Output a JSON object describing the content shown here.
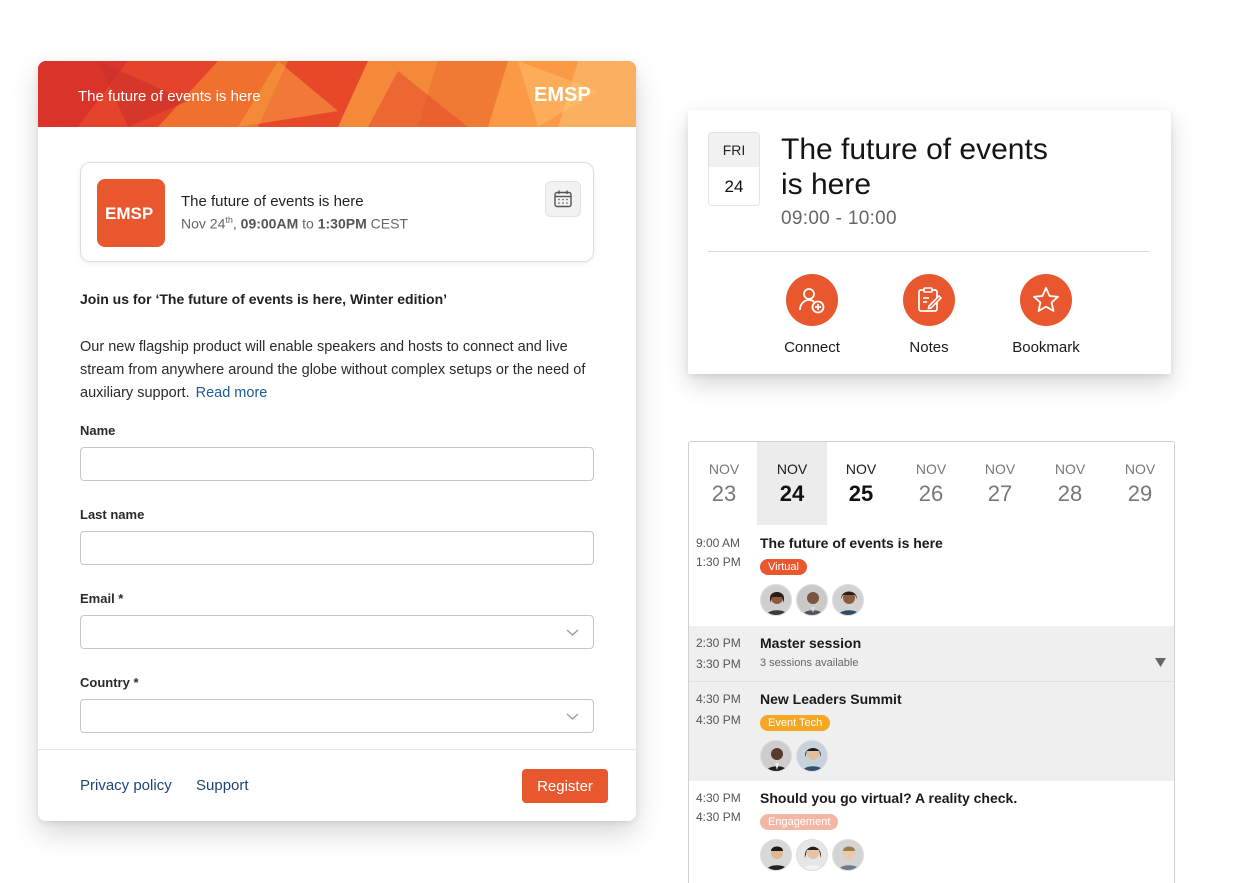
{
  "colors": {
    "brand_orange": "#e8572e",
    "tag_event_tech": "#f5a623",
    "tag_engagement": "#f5b7a5",
    "link_blue": "#1c4575"
  },
  "registration": {
    "banner_title": "The future of events is here",
    "brand_logo_text": "EMSP",
    "event": {
      "title": "The future of events is here",
      "date": "Nov 24",
      "date_suffix": "th",
      "date_comma": ",",
      "start": "09:00AM",
      "to": "to",
      "end": "1:30PM",
      "tz": "CEST"
    },
    "heading": "Join us for ‘The future of events is here, Winter edition’",
    "description": "Our new flagship product will enable speakers and hosts to connect and live stream from anywhere around the globe without complex setups or the need of auxiliary support.",
    "read_more": "Read more",
    "fields": {
      "name_label": "Name",
      "last_name_label": "Last name",
      "email_label": "Email *",
      "country_label": "Country *"
    },
    "footer": {
      "privacy": "Privacy policy",
      "support": "Support",
      "register": "Register"
    }
  },
  "detail": {
    "dow": "FRI",
    "dom": "24",
    "title_line1": "The future of events",
    "title_line2": "is here",
    "time": "09:00 - 10:00",
    "actions": {
      "connect": "Connect",
      "notes": "Notes",
      "bookmark": "Bookmark"
    }
  },
  "agenda": {
    "days": [
      {
        "mon": "NOV",
        "num": "23"
      },
      {
        "mon": "NOV",
        "num": "24"
      },
      {
        "mon": "NOV",
        "num": "25"
      },
      {
        "mon": "NOV",
        "num": "26"
      },
      {
        "mon": "NOV",
        "num": "27"
      },
      {
        "mon": "NOV",
        "num": "28"
      },
      {
        "mon": "NOV",
        "num": "29"
      }
    ],
    "sessions": [
      {
        "start": "9:00 AM",
        "end": "1:30 PM",
        "title": "The future of events is here",
        "tag": "Virtual"
      },
      {
        "start": "2:30 PM",
        "end": "3:30 PM",
        "title": "Master session",
        "subtitle": "3 sessions available"
      },
      {
        "start": "4:30 PM",
        "end": "4:30 PM",
        "title": "New Leaders Summit",
        "tag": "Event Tech"
      },
      {
        "start": "4:30 PM",
        "end": "4:30 PM",
        "title": "Should you go virtual? A reality check.",
        "tag": "Engagement"
      }
    ]
  }
}
